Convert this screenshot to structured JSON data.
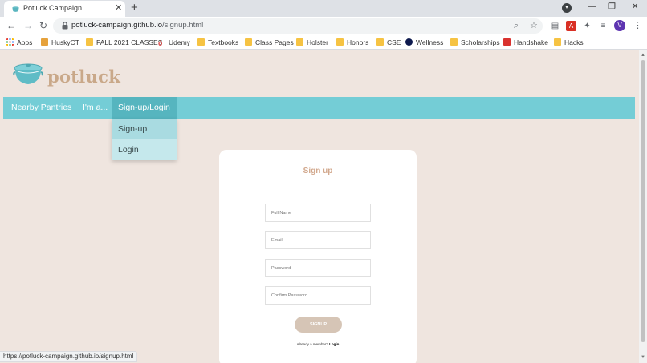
{
  "browser": {
    "tab_title": "Potluck Campaign",
    "tab_close": "✕",
    "new_tab": "+",
    "url_host": "potluck-campaign.github.io",
    "url_path": "/signup.html",
    "avatar_letter": "V",
    "status_url": "https://potluck-campaign.github.io/signup.html"
  },
  "bookmarks": [
    {
      "label": "Apps",
      "icon": "apps-grid-icon"
    },
    {
      "label": "HuskyCT",
      "icon": "huskyct-icon"
    },
    {
      "label": "FALL 2021 CLASSES",
      "icon": "folder-icon"
    },
    {
      "label": "Udemy",
      "icon": "udemy-icon"
    },
    {
      "label": "Textbooks",
      "icon": "folder-icon"
    },
    {
      "label": "Class Pages",
      "icon": "folder-icon"
    },
    {
      "label": "Holster",
      "icon": "folder-icon"
    },
    {
      "label": "Honors",
      "icon": "folder-icon"
    },
    {
      "label": "CSE",
      "icon": "folder-icon"
    },
    {
      "label": "Wellness",
      "icon": "uconn-icon"
    },
    {
      "label": "Scholarships",
      "icon": "folder-icon"
    },
    {
      "label": "Handshake",
      "icon": "handshake-icon"
    },
    {
      "label": "Hacks",
      "icon": "folder-icon"
    }
  ],
  "site": {
    "logo_text": "potluck",
    "nav": [
      {
        "label": "Nearby Pantries"
      },
      {
        "label": "I'm a..."
      },
      {
        "label": "Sign-up/Login"
      }
    ],
    "dropdown": [
      {
        "label": "Sign-up"
      },
      {
        "label": "Login"
      }
    ]
  },
  "form": {
    "title": "Sign up",
    "fields": [
      {
        "placeholder": "Full Name"
      },
      {
        "placeholder": "Email"
      },
      {
        "placeholder": "Password"
      },
      {
        "placeholder": "Confirm Password"
      }
    ],
    "submit_label": "SIGNUP",
    "already_text": "Already a member?",
    "login_link": "Login"
  },
  "colors": {
    "page_bg": "#efe5df",
    "navbar": "#74cdd6",
    "accent": "#d2a88d",
    "button": "#d6c5b6"
  }
}
